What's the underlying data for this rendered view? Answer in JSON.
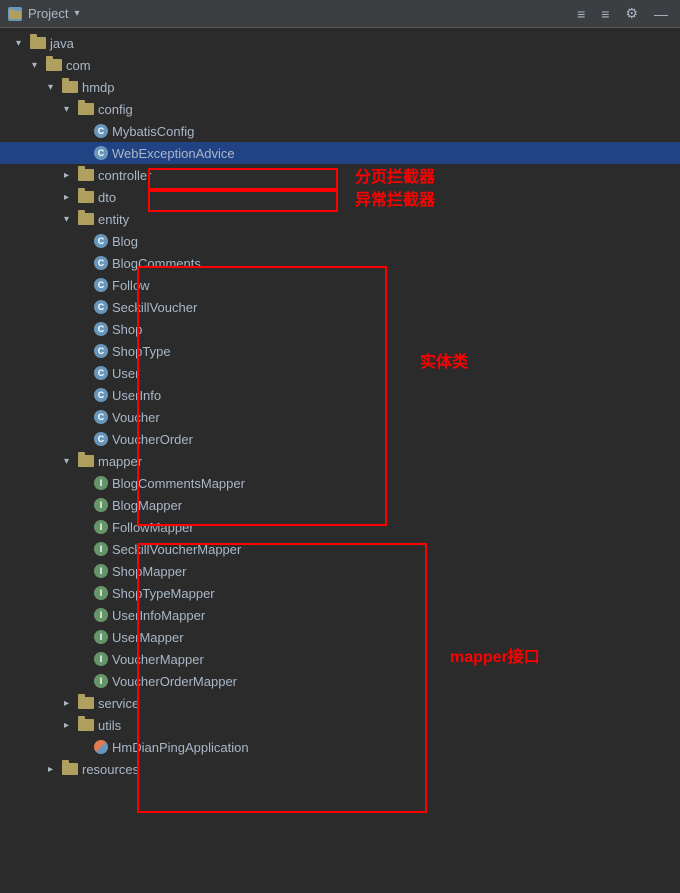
{
  "titleBar": {
    "title": "Project",
    "icons": [
      "≡",
      "≡",
      "⚙",
      "—"
    ]
  },
  "tree": {
    "items": [
      {
        "id": "java",
        "level": 1,
        "type": "folder",
        "label": "java",
        "open": true
      },
      {
        "id": "com",
        "level": 2,
        "type": "folder",
        "label": "com",
        "open": true
      },
      {
        "id": "hmdp",
        "level": 3,
        "type": "folder",
        "label": "hmdp",
        "open": true
      },
      {
        "id": "config",
        "level": 4,
        "type": "folder",
        "label": "config",
        "open": true
      },
      {
        "id": "MybatisConfig",
        "level": 5,
        "type": "class",
        "label": "MybatisConfig",
        "selected": false
      },
      {
        "id": "WebExceptionAdvice",
        "level": 5,
        "type": "class",
        "label": "WebExceptionAdvice",
        "selected": true
      },
      {
        "id": "controller",
        "level": 4,
        "type": "folder",
        "label": "controller",
        "open": false
      },
      {
        "id": "dto",
        "level": 4,
        "type": "folder",
        "label": "dto",
        "open": false
      },
      {
        "id": "entity",
        "level": 4,
        "type": "folder",
        "label": "entity",
        "open": true
      },
      {
        "id": "Blog",
        "level": 5,
        "type": "class",
        "label": "Blog"
      },
      {
        "id": "BlogComments",
        "level": 5,
        "type": "class",
        "label": "BlogComments"
      },
      {
        "id": "Follow",
        "level": 5,
        "type": "class",
        "label": "Follow"
      },
      {
        "id": "SeckillVoucher",
        "level": 5,
        "type": "class",
        "label": "SeckillVoucher"
      },
      {
        "id": "Shop",
        "level": 5,
        "type": "class",
        "label": "Shop"
      },
      {
        "id": "ShopType",
        "level": 5,
        "type": "class",
        "label": "ShopType"
      },
      {
        "id": "User",
        "level": 5,
        "type": "class",
        "label": "User"
      },
      {
        "id": "UserInfo",
        "level": 5,
        "type": "class",
        "label": "UserInfo"
      },
      {
        "id": "Voucher",
        "level": 5,
        "type": "class",
        "label": "Voucher"
      },
      {
        "id": "VoucherOrder",
        "level": 5,
        "type": "class",
        "label": "VoucherOrder"
      },
      {
        "id": "mapper",
        "level": 4,
        "type": "folder",
        "label": "mapper",
        "open": true
      },
      {
        "id": "BlogCommentsMapper",
        "level": 5,
        "type": "interface",
        "label": "BlogCommentsMapper"
      },
      {
        "id": "BlogMapper",
        "level": 5,
        "type": "interface",
        "label": "BlogMapper"
      },
      {
        "id": "FollowMapper",
        "level": 5,
        "type": "interface",
        "label": "FollowMapper"
      },
      {
        "id": "SeckillVoucherMapper",
        "level": 5,
        "type": "interface",
        "label": "SeckillVoucherMapper"
      },
      {
        "id": "ShopMapper",
        "level": 5,
        "type": "interface",
        "label": "ShopMapper"
      },
      {
        "id": "ShopTypeMapper",
        "level": 5,
        "type": "interface",
        "label": "ShopTypeMapper"
      },
      {
        "id": "UserInfoMapper",
        "level": 5,
        "type": "interface",
        "label": "UserInfoMapper"
      },
      {
        "id": "UserMapper",
        "level": 5,
        "type": "interface",
        "label": "UserMapper"
      },
      {
        "id": "VoucherMapper",
        "level": 5,
        "type": "interface",
        "label": "VoucherMapper"
      },
      {
        "id": "VoucherOrderMapper",
        "level": 5,
        "type": "interface",
        "label": "VoucherOrderMapper"
      },
      {
        "id": "service",
        "level": 4,
        "type": "folder",
        "label": "service",
        "open": false
      },
      {
        "id": "utils",
        "level": 4,
        "type": "folder",
        "label": "utils",
        "open": false
      },
      {
        "id": "HmDianPingApplication",
        "level": 5,
        "type": "app",
        "label": "HmDianPingApplication"
      },
      {
        "id": "resources",
        "level": 3,
        "type": "folder",
        "label": "resources",
        "open": false
      }
    ],
    "annotations": [
      {
        "id": "ann-mybatis",
        "label": "分页拦截器",
        "boxTop": 140,
        "boxLeft": 148,
        "boxWidth": 190,
        "boxHeight": 22,
        "labelTop": 135,
        "labelLeft": 355
      },
      {
        "id": "ann-webex",
        "label": "异常拦截器",
        "boxTop": 162,
        "boxLeft": 148,
        "boxWidth": 190,
        "boxHeight": 22,
        "labelTop": 158,
        "labelLeft": 355
      },
      {
        "id": "ann-entity",
        "label": "实体类",
        "boxTop": 238,
        "boxLeft": 137,
        "boxWidth": 250,
        "boxHeight": 260,
        "labelTop": 320,
        "labelLeft": 420
      },
      {
        "id": "ann-mapper",
        "label": "mapper接口",
        "boxTop": 515,
        "boxLeft": 137,
        "boxWidth": 290,
        "boxHeight": 270,
        "labelTop": 615,
        "labelLeft": 450
      }
    ]
  }
}
